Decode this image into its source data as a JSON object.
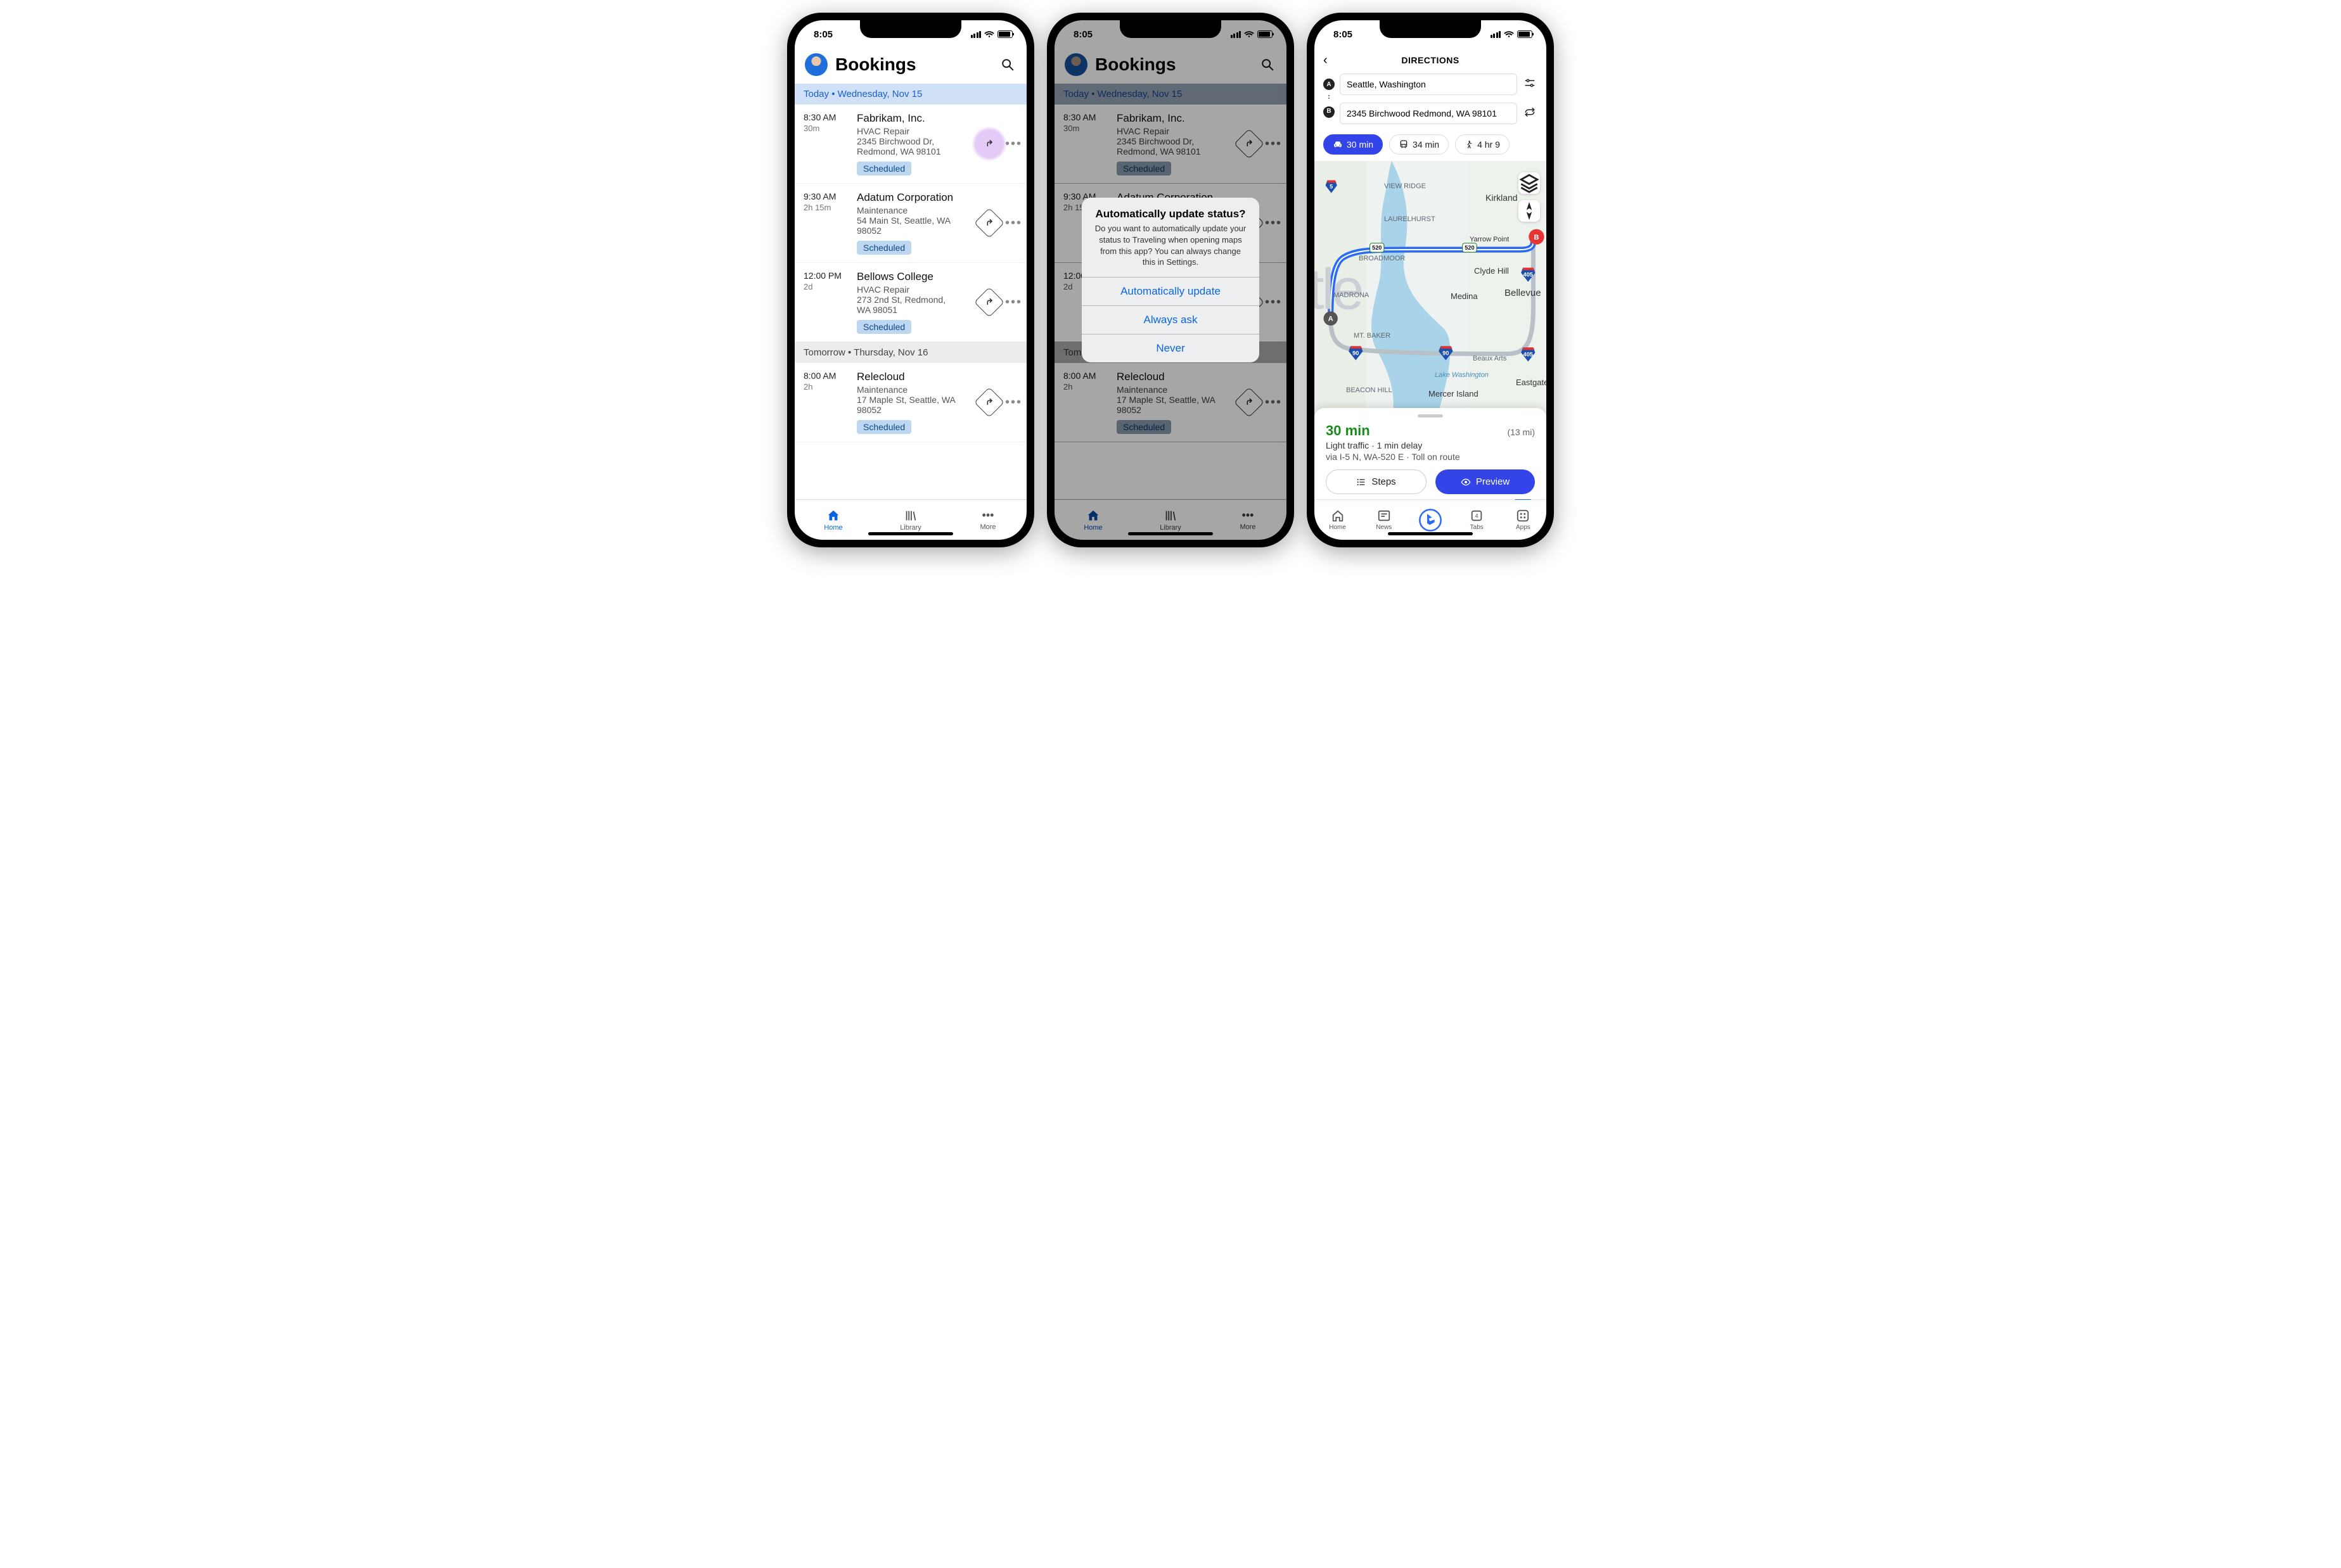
{
  "status": {
    "time": "8:05"
  },
  "bookings": {
    "title": "Bookings",
    "today_header": "Today • Wednesday, Nov 15",
    "tomorrow_header": "Tomorrow • Thursday, Nov 16",
    "status_label": "Scheduled",
    "items_today": [
      {
        "time": "8:30 AM",
        "dur": "30m",
        "cust": "Fabrikam, Inc.",
        "svc": "HVAC Repair",
        "addr1": "2345 Birchwood Dr,",
        "addr2": "Redmond, WA 98101",
        "highlight_dir": true
      },
      {
        "time": "9:30 AM",
        "dur": "2h 15m",
        "cust": "Adatum Corporation",
        "svc": "Maintenance",
        "addr1": "54 Main St, Seattle, WA",
        "addr2": "98052",
        "highlight_dir": false
      },
      {
        "time": "12:00 PM",
        "dur": "2d",
        "cust": "Bellows College",
        "svc": "HVAC Repair",
        "addr1": "273 2nd St, Redmond,",
        "addr2": "WA 98051",
        "highlight_dir": false
      }
    ],
    "items_tomorrow": [
      {
        "time": "8:00 AM",
        "dur": "2h",
        "cust": "Relecloud",
        "svc": "Maintenance",
        "addr1": "17 Maple St, Seattle, WA",
        "addr2": "98052",
        "highlight_dir": false
      }
    ],
    "tabs": {
      "home": "Home",
      "library": "Library",
      "more": "More"
    }
  },
  "alert": {
    "title": "Automatically update status?",
    "body": "Do you want to automatically update your status to Traveling when opening maps from this app? You can always change this in Settings.",
    "opt1": "Automatically update",
    "opt2": "Always ask",
    "opt3": "Never"
  },
  "directions": {
    "title": "DIRECTIONS",
    "origin": "Seattle, Washington",
    "dest": "2345 Birchwood Redmond, WA 98101",
    "modes": {
      "car": "30 min",
      "transit": "34 min",
      "walk": "4 hr 9"
    },
    "eta": "30 min",
    "distance": "(13 mi)",
    "traffic": "Light traffic · 1 min delay",
    "via": "via I-5 N, WA-520 E · Toll on route",
    "steps_btn": "Steps",
    "preview_btn": "Preview",
    "tabs2": {
      "home": "Home",
      "news": "News",
      "tabs": "Tabs",
      "apps": "Apps"
    },
    "map_labels": [
      "VIEW RIDGE",
      "Kirkland",
      "LAURELHURST",
      "Yarrow Point",
      "BROADMOOR",
      "Clyde Hill",
      "MADRONA",
      "Medina",
      "Bellevue",
      "MT. BAKER",
      "Beaux Arts",
      "Lake Washington",
      "Eastgate",
      "BEACON HILL",
      "Mercer Island"
    ],
    "shields": [
      "5",
      "520",
      "520",
      "405",
      "90",
      "90",
      "405"
    ]
  }
}
